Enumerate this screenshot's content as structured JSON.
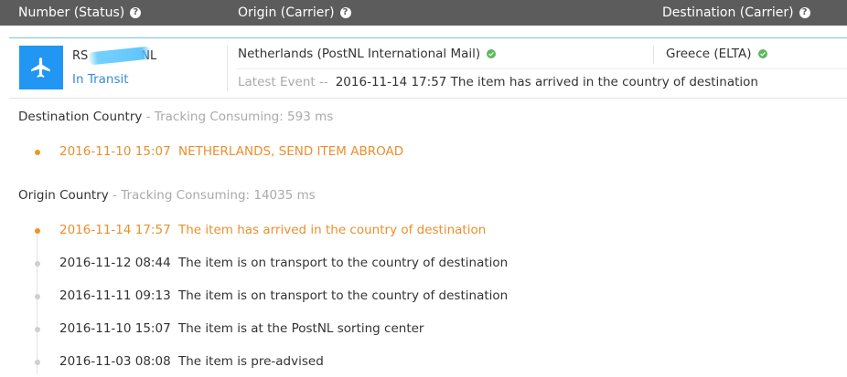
{
  "header": {
    "col_number": "Number (Status)",
    "col_origin": "Origin (Carrier)",
    "col_destination": "Destination (Carrier)",
    "help_glyph": "?"
  },
  "shipment": {
    "number_prefix": "RS",
    "number_suffix": "NL",
    "status": "In Transit",
    "icon": "airplane-icon",
    "origin_carrier": "Netherlands (PostNL International Mail)",
    "destination_carrier": "Greece (ELTA)",
    "latest_event_label": "Latest Event --",
    "latest_event": "2016-11-14 17:57 The item has arrived in the country of destination"
  },
  "destination_section": {
    "title": "Destination Country",
    "consuming": " - Tracking Consuming: 593 ms",
    "events": [
      {
        "time": "2016-11-10 15:07",
        "desc": "NETHERLANDS, SEND ITEM ABROAD"
      }
    ]
  },
  "origin_section": {
    "title": "Origin Country",
    "consuming": " - Tracking Consuming: 14035 ms",
    "events": [
      {
        "time": "2016-11-14 17:57",
        "desc": "The item has arrived in the country of destination"
      },
      {
        "time": "2016-11-12 08:44",
        "desc": "The item is on transport to the country of destination"
      },
      {
        "time": "2016-11-11 09:13",
        "desc": "The item is on transport to the country of destination"
      },
      {
        "time": "2016-11-10 15:07",
        "desc": "The item is at the PostNL sorting center"
      },
      {
        "time": "2016-11-03 08:08",
        "desc": "The item is pre-advised"
      }
    ]
  },
  "colors": {
    "header_bg": "#5c5c5c",
    "accent_blue": "#2196f3",
    "status_blue": "#3a8ad6",
    "current_orange": "#e8902e",
    "check_green": "#5cb85c"
  }
}
